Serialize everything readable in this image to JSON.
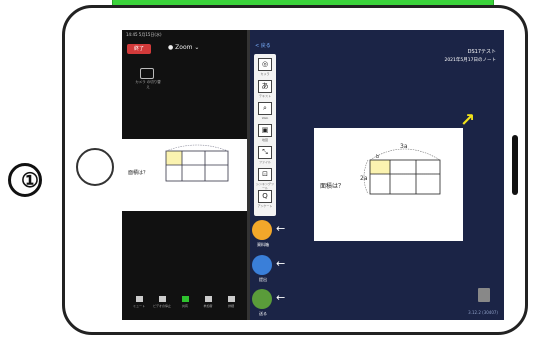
{
  "zoom": {
    "status_time": "14:45 5月15日(水)",
    "exit_label": "終了",
    "app_name": "Zoom",
    "camera_label": "カメラ\nの切り替え",
    "share_question": "面積は？",
    "toolbar": [
      {
        "label": "ミュート",
        "green": false
      },
      {
        "label": "ビデオの停止",
        "green": false
      },
      {
        "label": "共有",
        "green": true
      },
      {
        "label": "参加者",
        "green": false
      },
      {
        "label": "詳細",
        "green": false
      }
    ]
  },
  "app": {
    "back_label": "戻る",
    "title": "DS17テスト",
    "subtitle": "2021年5月17日のノート",
    "tools": [
      {
        "glyph": "◎",
        "label": "カメラ"
      },
      {
        "glyph": "あ",
        "label": "テキスト"
      },
      {
        "glyph": "⌕",
        "label": "Web"
      },
      {
        "glyph": "▣",
        "label": "地図"
      },
      {
        "glyph": "⤡",
        "label": "ファイル"
      },
      {
        "glyph": "⊡",
        "label": "シンキングツール"
      },
      {
        "glyph": "Q",
        "label": "アンケート"
      }
    ],
    "actions": [
      {
        "label": "資料箱"
      },
      {
        "label": "提出"
      },
      {
        "label": "送る"
      }
    ],
    "canvas_question": "面積は？",
    "canvas_dim_top": "3a",
    "canvas_dim_small": "b",
    "canvas_dim_side": "2a",
    "version": "3.12.2 (30407)"
  },
  "colors": {
    "app_bg": "#1b2446",
    "zoom_bg": "#111111",
    "highlight": "#fbf3b0",
    "accent_yellow": "#f2e21a",
    "exit_red": "#d23a3a",
    "green_bar": "#3bd33b"
  },
  "annotation": {
    "circle_label": "①"
  }
}
